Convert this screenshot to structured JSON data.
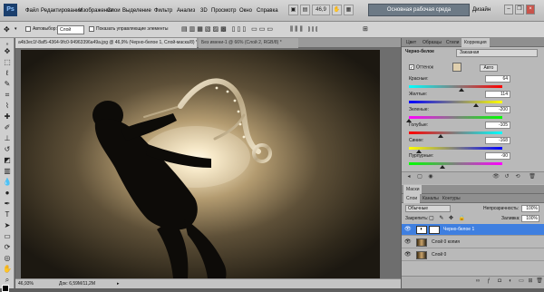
{
  "app": {
    "logo": "Ps",
    "zoom": "46,9",
    "workspace_main": "Основная рабочая среда",
    "workspace_design": "Дизайн"
  },
  "menu": [
    "Файл",
    "Редактирование",
    "Изображение",
    "Слои",
    "Выделение",
    "Фильтр",
    "Анализ",
    "3D",
    "Просмотр",
    "Окно",
    "Справка"
  ],
  "options": {
    "autoselect": "Автовыбор:",
    "autoselect_value": "Слой",
    "show_controls": "Показать управляющие элементы"
  },
  "documents": {
    "tab1": "a4b3ec1f-8af5-4364-9fc0-94963396a49a.jpg @ 46,9% (Черно-белое 1, Слой-маска/8) *",
    "tab2": "Без имени-1 @ 66% (Слой 2, RGB/8) *"
  },
  "status": {
    "zoom": "46,93%",
    "doc": "Док: 6,59M/11,2M"
  },
  "adjustments": {
    "tabs": [
      "Цвет",
      "Образцы",
      "Стили",
      "Коррекция"
    ],
    "title": "Черно-белое",
    "preset": "Заказная",
    "tint_label": "Оттенок",
    "tint_color": "#dfcfae",
    "auto": "Авто",
    "sliders": [
      {
        "label": "Красные:",
        "value": "64",
        "fraction": 0.56,
        "colors": [
          "#00ffff",
          "#ff0000"
        ]
      },
      {
        "label": "Желтые:",
        "value": "114",
        "fraction": 0.72,
        "colors": [
          "#0000ff",
          "#ffff00"
        ]
      },
      {
        "label": "Зеленые:",
        "value": "-200",
        "fraction": 0.0,
        "colors": [
          "#ff00ff",
          "#00ff00"
        ]
      },
      {
        "label": "Голубые:",
        "value": "-105",
        "fraction": 0.34,
        "colors": [
          "#ff0000",
          "#00ffff"
        ]
      },
      {
        "label": "Синие:",
        "value": "-168",
        "fraction": 0.11,
        "colors": [
          "#ffff00",
          "#0000ff"
        ]
      },
      {
        "label": "Пурпурные:",
        "value": "-90",
        "fraction": 0.36,
        "colors": [
          "#00ff00",
          "#ff00ff"
        ]
      }
    ]
  },
  "masks": {
    "title": "Маски"
  },
  "layers": {
    "tabs": [
      "Слои",
      "Каналы",
      "Контуры"
    ],
    "blend": "Обычные",
    "opacity_label": "Непрозрачность:",
    "opacity": "100%",
    "lock_label": "Закрепить:",
    "fill_label": "Заливка:",
    "fill": "100%",
    "items": [
      "Черно-белое 1",
      "Слой 0 копия",
      "Слой 0"
    ]
  }
}
